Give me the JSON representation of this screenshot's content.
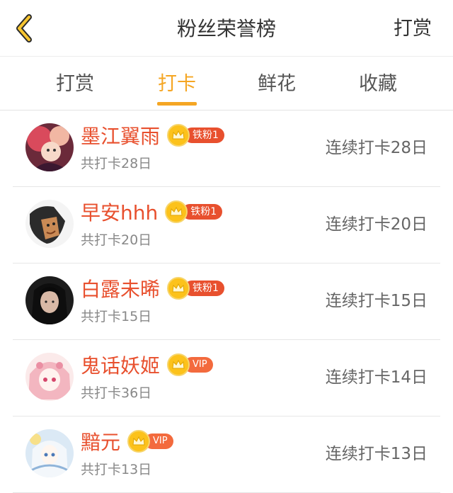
{
  "header": {
    "back_icon": "chevron-left-icon",
    "title": "粉丝荣誉榜",
    "action_label": "打赏"
  },
  "tabs": [
    {
      "label": "打赏",
      "active": false
    },
    {
      "label": "打卡",
      "active": true
    },
    {
      "label": "鲜花",
      "active": false
    },
    {
      "label": "收藏",
      "active": false
    }
  ],
  "colors": {
    "accent": "#f5a623",
    "name": "#e8502e",
    "badge": "#e8502e",
    "crown": "#fcc21b"
  },
  "list": [
    {
      "name": "墨江翼雨",
      "badge_icon": "crown-icon",
      "badge": "铁粉1",
      "total": "共打卡28日",
      "streak": "连续打卡28日"
    },
    {
      "name": "早安hhh",
      "badge_icon": "crown-icon",
      "badge": "铁粉1",
      "total": "共打卡20日",
      "streak": "连续打卡20日"
    },
    {
      "name": "白露未晞",
      "badge_icon": "crown-icon",
      "badge": "铁粉1",
      "total": "共打卡15日",
      "streak": "连续打卡15日"
    },
    {
      "name": "鬼话妖姬",
      "badge_icon": "crown-icon",
      "badge": "VIP",
      "total": "共打卡36日",
      "streak": "连续打卡14日"
    },
    {
      "name": "黯元",
      "badge_icon": "crown-icon",
      "badge": "VIP",
      "total": "共打卡13日",
      "streak": "连续打卡13日"
    }
  ]
}
